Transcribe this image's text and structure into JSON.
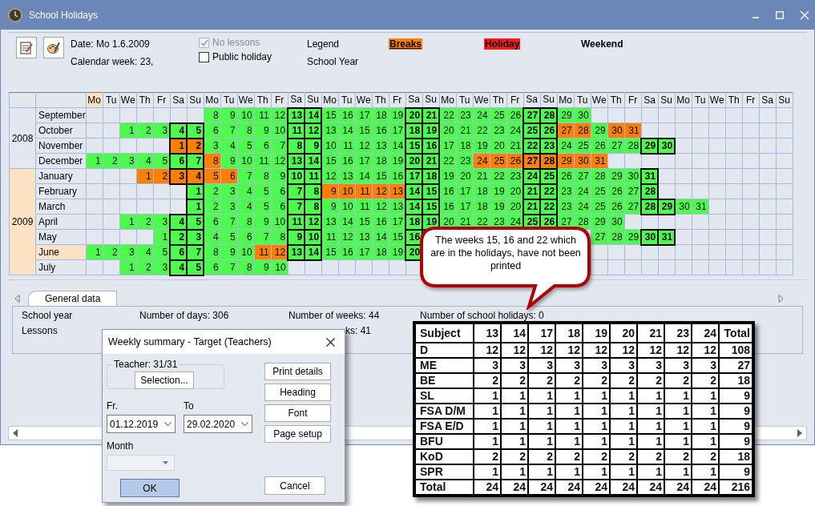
{
  "window": {
    "title": "School Holidays"
  },
  "toolbar": {
    "date": "Date: Mo 1.6.2009",
    "week": "Calendar week: 23,",
    "checkboxes": [
      {
        "label": "No lessons",
        "checked": true,
        "disabled": true
      },
      {
        "label": "Public holiday",
        "checked": false,
        "disabled": false
      }
    ],
    "legend_title": "Legend",
    "school_year_label": "School Year",
    "legend": [
      {
        "label": "Breaks",
        "kind": "break"
      },
      {
        "label": "Holiday",
        "kind": "holiday"
      },
      {
        "label": "Weekend",
        "kind": "weekend"
      }
    ]
  },
  "calendar": {
    "headers": [
      {
        "label": "Mo",
        "selected": true
      },
      {
        "label": "Tu",
        "selected": false
      },
      {
        "label": "We",
        "selected": false
      },
      {
        "label": "Th",
        "selected": false
      },
      {
        "label": "Fr",
        "selected": false
      },
      {
        "label": "Sa",
        "selected": false
      },
      {
        "label": "Su",
        "selected": false
      },
      {
        "label": "Mo",
        "selected": false
      },
      {
        "label": "Tu",
        "selected": false
      },
      {
        "label": "We",
        "selected": false
      },
      {
        "label": "Th",
        "selected": false
      },
      {
        "label": "Fr",
        "selected": false
      },
      {
        "label": "Sa",
        "selected": false
      },
      {
        "label": "Su",
        "selected": false
      },
      {
        "label": "Mo",
        "selected": false
      },
      {
        "label": "Tu",
        "selected": false
      },
      {
        "label": "We",
        "selected": false
      },
      {
        "label": "Th",
        "selected": false
      },
      {
        "label": "Fr",
        "selected": false
      },
      {
        "label": "Sa",
        "selected": false
      },
      {
        "label": "Su",
        "selected": false
      },
      {
        "label": "Mo",
        "selected": false
      },
      {
        "label": "Tu",
        "selected": false
      },
      {
        "label": "We",
        "selected": false
      },
      {
        "label": "Th",
        "selected": false
      },
      {
        "label": "Fr",
        "selected": false
      },
      {
        "label": "Sa",
        "selected": false
      },
      {
        "label": "Su",
        "selected": false
      },
      {
        "label": "Mo",
        "selected": false
      },
      {
        "label": "Tu",
        "selected": false
      },
      {
        "label": "We",
        "selected": false
      },
      {
        "label": "Th",
        "selected": false
      },
      {
        "label": "Fr",
        "selected": false
      },
      {
        "label": "Sa",
        "selected": false
      },
      {
        "label": "Su",
        "selected": false
      },
      {
        "label": "Mo",
        "selected": false
      },
      {
        "label": "Tu",
        "selected": false
      },
      {
        "label": "We",
        "selected": false
      },
      {
        "label": "Th",
        "selected": false
      },
      {
        "label": "Fr",
        "selected": false
      },
      {
        "label": "Sa",
        "selected": false
      },
      {
        "label": "Su",
        "selected": false
      }
    ],
    "years": [
      {
        "year": "2008",
        "selected": false,
        "months": [
          {
            "name": "September",
            "selected": false,
            "cells": [
              {
                "kind": "blank"
              },
              {
                "kind": "blank"
              },
              {
                "kind": "blank"
              },
              {
                "kind": "blank"
              },
              {
                "kind": "blank"
              },
              {
                "kind": "blank"
              },
              {
                "kind": "blank"
              },
              {
                "day": "8",
                "kind": "school"
              },
              {
                "day": "9",
                "kind": "school"
              },
              {
                "day": "10",
                "kind": "school"
              },
              {
                "day": "11",
                "kind": "school"
              },
              {
                "day": "12",
                "kind": "school"
              },
              {
                "day": "13",
                "kind": "school"
              },
              {
                "day": "14",
                "kind": "school"
              },
              {
                "day": "15",
                "kind": "school"
              },
              {
                "day": "16",
                "kind": "school"
              },
              {
                "day": "17",
                "kind": "school"
              },
              {
                "day": "18",
                "kind": "school"
              },
              {
                "day": "19",
                "kind": "school"
              },
              {
                "day": "20",
                "kind": "school"
              },
              {
                "day": "21",
                "kind": "school"
              },
              {
                "day": "22",
                "kind": "school"
              },
              {
                "day": "23",
                "kind": "school"
              },
              {
                "day": "24",
                "kind": "school"
              },
              {
                "day": "25",
                "kind": "school"
              },
              {
                "day": "26",
                "kind": "school"
              },
              {
                "day": "27",
                "kind": "school"
              },
              {
                "day": "28",
                "kind": "school"
              },
              {
                "day": "29",
                "kind": "school"
              },
              {
                "day": "30",
                "kind": "school"
              }
            ]
          },
          {
            "name": "October",
            "selected": false,
            "cells": [
              {
                "kind": "blank"
              },
              {
                "kind": "blank"
              },
              {
                "day": "1",
                "kind": "school"
              },
              {
                "day": "2",
                "kind": "school"
              },
              {
                "day": "3",
                "kind": "school"
              },
              {
                "day": "4",
                "kind": "school"
              },
              {
                "day": "5",
                "kind": "school"
              },
              {
                "day": "6",
                "kind": "school"
              },
              {
                "day": "7",
                "kind": "school"
              },
              {
                "day": "8",
                "kind": "school"
              },
              {
                "day": "9",
                "kind": "school"
              },
              {
                "day": "10",
                "kind": "school"
              },
              {
                "day": "11",
                "kind": "school"
              },
              {
                "day": "12",
                "kind": "school"
              },
              {
                "day": "13",
                "kind": "school"
              },
              {
                "day": "14",
                "kind": "school"
              },
              {
                "day": "15",
                "kind": "school"
              },
              {
                "day": "16",
                "kind": "school"
              },
              {
                "day": "17",
                "kind": "school"
              },
              {
                "day": "18",
                "kind": "school"
              },
              {
                "day": "19",
                "kind": "school"
              },
              {
                "day": "20",
                "kind": "school"
              },
              {
                "day": "21",
                "kind": "school"
              },
              {
                "day": "22",
                "kind": "school"
              },
              {
                "day": "23",
                "kind": "school"
              },
              {
                "day": "24",
                "kind": "school"
              },
              {
                "day": "25",
                "kind": "school"
              },
              {
                "day": "26",
                "kind": "school"
              },
              {
                "day": "27",
                "kind": "break"
              },
              {
                "day": "28",
                "kind": "break"
              },
              {
                "day": "29",
                "kind": "school"
              },
              {
                "day": "30",
                "kind": "break"
              },
              {
                "day": "31",
                "kind": "break"
              }
            ]
          },
          {
            "name": "November",
            "selected": false,
            "cells": [
              {
                "kind": "blank"
              },
              {
                "kind": "blank"
              },
              {
                "kind": "blank"
              },
              {
                "kind": "blank"
              },
              {
                "kind": "blank"
              },
              {
                "day": "1",
                "kind": "break"
              },
              {
                "day": "2",
                "kind": "break"
              },
              {
                "day": "3",
                "kind": "school"
              },
              {
                "day": "4",
                "kind": "school"
              },
              {
                "day": "5",
                "kind": "school"
              },
              {
                "day": "6",
                "kind": "school"
              },
              {
                "day": "7",
                "kind": "school"
              },
              {
                "day": "8",
                "kind": "school"
              },
              {
                "day": "9",
                "kind": "school"
              },
              {
                "day": "10",
                "kind": "school"
              },
              {
                "day": "11",
                "kind": "school"
              },
              {
                "day": "12",
                "kind": "school"
              },
              {
                "day": "13",
                "kind": "school"
              },
              {
                "day": "14",
                "kind": "school"
              },
              {
                "day": "15",
                "kind": "school"
              },
              {
                "day": "16",
                "kind": "school"
              },
              {
                "day": "17",
                "kind": "school"
              },
              {
                "day": "18",
                "kind": "school"
              },
              {
                "day": "19",
                "kind": "school"
              },
              {
                "day": "20",
                "kind": "school"
              },
              {
                "day": "21",
                "kind": "school"
              },
              {
                "day": "22",
                "kind": "school"
              },
              {
                "day": "23",
                "kind": "school"
              },
              {
                "day": "24",
                "kind": "school"
              },
              {
                "day": "25",
                "kind": "school"
              },
              {
                "day": "26",
                "kind": "school"
              },
              {
                "day": "27",
                "kind": "school"
              },
              {
                "day": "28",
                "kind": "school"
              },
              {
                "day": "29",
                "kind": "school"
              },
              {
                "day": "30",
                "kind": "school"
              }
            ]
          },
          {
            "name": "December",
            "selected": false,
            "cells": [
              {
                "day": "1",
                "kind": "school"
              },
              {
                "day": "2",
                "kind": "school"
              },
              {
                "day": "3",
                "kind": "school"
              },
              {
                "day": "4",
                "kind": "school"
              },
              {
                "day": "5",
                "kind": "school"
              },
              {
                "day": "6",
                "kind": "school"
              },
              {
                "day": "7",
                "kind": "school"
              },
              {
                "day": "8",
                "kind": "break"
              },
              {
                "day": "9",
                "kind": "school"
              },
              {
                "day": "10",
                "kind": "school"
              },
              {
                "day": "11",
                "kind": "school"
              },
              {
                "day": "12",
                "kind": "school"
              },
              {
                "day": "13",
                "kind": "school"
              },
              {
                "day": "14",
                "kind": "school"
              },
              {
                "day": "15",
                "kind": "school"
              },
              {
                "day": "16",
                "kind": "school"
              },
              {
                "day": "17",
                "kind": "school"
              },
              {
                "day": "18",
                "kind": "school"
              },
              {
                "day": "19",
                "kind": "school"
              },
              {
                "day": "20",
                "kind": "school"
              },
              {
                "day": "21",
                "kind": "school"
              },
              {
                "day": "22",
                "kind": "school"
              },
              {
                "day": "23",
                "kind": "school"
              },
              {
                "day": "24",
                "kind": "break"
              },
              {
                "day": "25",
                "kind": "break"
              },
              {
                "day": "26",
                "kind": "break"
              },
              {
                "day": "27",
                "kind": "break"
              },
              {
                "day": "28",
                "kind": "break"
              },
              {
                "day": "29",
                "kind": "break"
              },
              {
                "day": "30",
                "kind": "break"
              },
              {
                "day": "31",
                "kind": "break"
              }
            ]
          }
        ]
      },
      {
        "year": "2009",
        "selected": true,
        "months": [
          {
            "name": "January",
            "selected": false,
            "cells": [
              {
                "kind": "blank"
              },
              {
                "kind": "blank"
              },
              {
                "kind": "blank"
              },
              {
                "day": "1",
                "kind": "break"
              },
              {
                "day": "2",
                "kind": "break"
              },
              {
                "day": "3",
                "kind": "break"
              },
              {
                "day": "4",
                "kind": "break"
              },
              {
                "day": "5",
                "kind": "break"
              },
              {
                "day": "6",
                "kind": "break"
              },
              {
                "day": "7",
                "kind": "school"
              },
              {
                "day": "8",
                "kind": "school"
              },
              {
                "day": "9",
                "kind": "school"
              },
              {
                "day": "10",
                "kind": "school"
              },
              {
                "day": "11",
                "kind": "school"
              },
              {
                "day": "12",
                "kind": "school"
              },
              {
                "day": "13",
                "kind": "school"
              },
              {
                "day": "14",
                "kind": "school"
              },
              {
                "day": "15",
                "kind": "school"
              },
              {
                "day": "16",
                "kind": "school"
              },
              {
                "day": "17",
                "kind": "school"
              },
              {
                "day": "18",
                "kind": "school"
              },
              {
                "day": "19",
                "kind": "school"
              },
              {
                "day": "20",
                "kind": "school"
              },
              {
                "day": "21",
                "kind": "school"
              },
              {
                "day": "22",
                "kind": "school"
              },
              {
                "day": "23",
                "kind": "school"
              },
              {
                "day": "24",
                "kind": "school"
              },
              {
                "day": "25",
                "kind": "school"
              },
              {
                "day": "26",
                "kind": "school"
              },
              {
                "day": "27",
                "kind": "school"
              },
              {
                "day": "28",
                "kind": "school"
              },
              {
                "day": "29",
                "kind": "school"
              },
              {
                "day": "30",
                "kind": "school"
              },
              {
                "day": "31",
                "kind": "school"
              }
            ]
          },
          {
            "name": "February",
            "selected": false,
            "cells": [
              {
                "kind": "blank"
              },
              {
                "kind": "blank"
              },
              {
                "kind": "blank"
              },
              {
                "kind": "blank"
              },
              {
                "kind": "blank"
              },
              {
                "kind": "blank"
              },
              {
                "day": "1",
                "kind": "school"
              },
              {
                "day": "2",
                "kind": "school"
              },
              {
                "day": "3",
                "kind": "school"
              },
              {
                "day": "4",
                "kind": "school"
              },
              {
                "day": "5",
                "kind": "school"
              },
              {
                "day": "6",
                "kind": "school"
              },
              {
                "day": "7",
                "kind": "school"
              },
              {
                "day": "8",
                "kind": "school"
              },
              {
                "day": "9",
                "kind": "break"
              },
              {
                "day": "10",
                "kind": "break"
              },
              {
                "day": "11",
                "kind": "break"
              },
              {
                "day": "12",
                "kind": "break"
              },
              {
                "day": "13",
                "kind": "break"
              },
              {
                "day": "14",
                "kind": "school"
              },
              {
                "day": "15",
                "kind": "school"
              },
              {
                "day": "16",
                "kind": "school"
              },
              {
                "day": "17",
                "kind": "school"
              },
              {
                "day": "18",
                "kind": "school"
              },
              {
                "day": "19",
                "kind": "school"
              },
              {
                "day": "20",
                "kind": "school"
              },
              {
                "day": "21",
                "kind": "school"
              },
              {
                "day": "22",
                "kind": "school"
              },
              {
                "day": "23",
                "kind": "school"
              },
              {
                "day": "24",
                "kind": "school"
              },
              {
                "day": "25",
                "kind": "school"
              },
              {
                "day": "26",
                "kind": "school"
              },
              {
                "day": "27",
                "kind": "school"
              },
              {
                "day": "28",
                "kind": "school"
              }
            ]
          },
          {
            "name": "March",
            "selected": false,
            "cells": [
              {
                "kind": "blank"
              },
              {
                "kind": "blank"
              },
              {
                "kind": "blank"
              },
              {
                "kind": "blank"
              },
              {
                "kind": "blank"
              },
              {
                "kind": "blank"
              },
              {
                "day": "1",
                "kind": "school"
              },
              {
                "day": "2",
                "kind": "school"
              },
              {
                "day": "3",
                "kind": "school"
              },
              {
                "day": "4",
                "kind": "school"
              },
              {
                "day": "5",
                "kind": "school"
              },
              {
                "day": "6",
                "kind": "school"
              },
              {
                "day": "7",
                "kind": "school"
              },
              {
                "day": "8",
                "kind": "school"
              },
              {
                "day": "9",
                "kind": "school"
              },
              {
                "day": "10",
                "kind": "school"
              },
              {
                "day": "11",
                "kind": "school"
              },
              {
                "day": "12",
                "kind": "school"
              },
              {
                "day": "13",
                "kind": "school"
              },
              {
                "day": "14",
                "kind": "school"
              },
              {
                "day": "15",
                "kind": "school"
              },
              {
                "day": "16",
                "kind": "school"
              },
              {
                "day": "17",
                "kind": "school"
              },
              {
                "day": "18",
                "kind": "school"
              },
              {
                "day": "19",
                "kind": "school"
              },
              {
                "day": "20",
                "kind": "school"
              },
              {
                "day": "21",
                "kind": "school"
              },
              {
                "day": "22",
                "kind": "school"
              },
              {
                "day": "23",
                "kind": "school"
              },
              {
                "day": "24",
                "kind": "school"
              },
              {
                "day": "25",
                "kind": "school"
              },
              {
                "day": "26",
                "kind": "school"
              },
              {
                "day": "27",
                "kind": "school"
              },
              {
                "day": "28",
                "kind": "school"
              },
              {
                "day": "29",
                "kind": "school"
              },
              {
                "day": "30",
                "kind": "school"
              },
              {
                "day": "31",
                "kind": "school"
              }
            ]
          },
          {
            "name": "April",
            "selected": false,
            "cells": [
              {
                "kind": "blank"
              },
              {
                "kind": "blank"
              },
              {
                "day": "1",
                "kind": "school"
              },
              {
                "day": "2",
                "kind": "school"
              },
              {
                "day": "3",
                "kind": "school"
              },
              {
                "day": "4",
                "kind": "school"
              },
              {
                "day": "5",
                "kind": "school"
              },
              {
                "day": "6",
                "kind": "school"
              },
              {
                "day": "7",
                "kind": "school"
              },
              {
                "day": "8",
                "kind": "school"
              },
              {
                "day": "9",
                "kind": "school"
              },
              {
                "day": "10",
                "kind": "school"
              },
              {
                "day": "11",
                "kind": "school"
              },
              {
                "day": "12",
                "kind": "school"
              },
              {
                "day": "13",
                "kind": "school"
              },
              {
                "day": "14",
                "kind": "school"
              },
              {
                "day": "15",
                "kind": "school"
              },
              {
                "day": "16",
                "kind": "school"
              },
              {
                "day": "17",
                "kind": "school"
              },
              {
                "day": "18",
                "kind": "school"
              },
              {
                "day": "19",
                "kind": "school"
              },
              {
                "day": "20",
                "kind": "school"
              },
              {
                "day": "21",
                "kind": "school"
              },
              {
                "day": "22",
                "kind": "school"
              },
              {
                "day": "23",
                "kind": "school"
              },
              {
                "day": "24",
                "kind": "school"
              },
              {
                "day": "25",
                "kind": "school"
              },
              {
                "day": "26",
                "kind": "school"
              },
              {
                "day": "27",
                "kind": "school"
              },
              {
                "day": "28",
                "kind": "school"
              },
              {
                "day": "29",
                "kind": "school"
              },
              {
                "day": "30",
                "kind": "school"
              }
            ]
          },
          {
            "name": "May",
            "selected": false,
            "cells": [
              {
                "kind": "blank"
              },
              {
                "kind": "blank"
              },
              {
                "kind": "blank"
              },
              {
                "kind": "blank"
              },
              {
                "day": "1",
                "kind": "school"
              },
              {
                "day": "2",
                "kind": "school"
              },
              {
                "day": "3",
                "kind": "school"
              },
              {
                "day": "4",
                "kind": "school"
              },
              {
                "day": "5",
                "kind": "school"
              },
              {
                "day": "6",
                "kind": "school"
              },
              {
                "day": "7",
                "kind": "school"
              },
              {
                "day": "8",
                "kind": "school"
              },
              {
                "day": "9",
                "kind": "school"
              },
              {
                "day": "10",
                "kind": "school"
              },
              {
                "day": "11",
                "kind": "school"
              },
              {
                "day": "12",
                "kind": "school"
              },
              {
                "day": "13",
                "kind": "school"
              },
              {
                "day": "14",
                "kind": "school"
              },
              {
                "day": "15",
                "kind": "school"
              },
              {
                "day": "16",
                "kind": "school"
              },
              {
                "kind": "blank"
              },
              {
                "kind": "blank"
              },
              {
                "kind": "blank"
              },
              {
                "kind": "blank"
              },
              {
                "kind": "blank"
              },
              {
                "kind": "blank"
              },
              {
                "kind": "blank"
              },
              {
                "kind": "blank"
              },
              {
                "kind": "blank"
              },
              {
                "kind": "blank"
              },
              {
                "day": "27",
                "kind": "school"
              },
              {
                "day": "28",
                "kind": "school"
              },
              {
                "day": "29",
                "kind": "school"
              },
              {
                "day": "30",
                "kind": "school"
              },
              {
                "day": "31",
                "kind": "school"
              }
            ]
          },
          {
            "name": "June",
            "selected": true,
            "cells": [
              {
                "day": "1",
                "kind": "school"
              },
              {
                "day": "2",
                "kind": "school"
              },
              {
                "day": "3",
                "kind": "school"
              },
              {
                "day": "4",
                "kind": "school"
              },
              {
                "day": "5",
                "kind": "school"
              },
              {
                "day": "6",
                "kind": "school"
              },
              {
                "day": "7",
                "kind": "school"
              },
              {
                "day": "8",
                "kind": "school"
              },
              {
                "day": "9",
                "kind": "school"
              },
              {
                "day": "10",
                "kind": "school"
              },
              {
                "day": "11",
                "kind": "break"
              },
              {
                "day": "12",
                "kind": "break"
              },
              {
                "day": "13",
                "kind": "school"
              },
              {
                "day": "14",
                "kind": "school"
              },
              {
                "day": "15",
                "kind": "school"
              },
              {
                "day": "16",
                "kind": "school"
              },
              {
                "day": "17",
                "kind": "school"
              },
              {
                "day": "18",
                "kind": "school"
              },
              {
                "day": "19",
                "kind": "school"
              },
              {
                "day": "20",
                "kind": "school"
              }
            ]
          },
          {
            "name": "July",
            "selected": false,
            "cells": [
              {
                "kind": "blank"
              },
              {
                "kind": "blank"
              },
              {
                "day": "1",
                "kind": "school"
              },
              {
                "day": "2",
                "kind": "school"
              },
              {
                "day": "3",
                "kind": "school"
              },
              {
                "day": "4",
                "kind": "school"
              },
              {
                "day": "5",
                "kind": "school"
              },
              {
                "day": "6",
                "kind": "school"
              },
              {
                "day": "7",
                "kind": "school"
              },
              {
                "day": "8",
                "kind": "school"
              },
              {
                "day": "9",
                "kind": "school"
              },
              {
                "day": "10",
                "kind": "school"
              }
            ]
          }
        ]
      }
    ]
  },
  "general": {
    "tabs": [
      {
        "label": "General data",
        "selected": true
      }
    ],
    "info_rows": [
      [
        "School year",
        "Number of days: 306",
        "Number of weeks: 44",
        "Number of school holidays: 0"
      ],
      [
        "Lessons",
        "ks: 41"
      ]
    ]
  },
  "dialog": {
    "title": "Weekly summary - Target (Teachers)",
    "group_label": "Teacher: 31/31",
    "selection_button": "Selection...",
    "from_label": "Fr.",
    "from_value": "01.12.2019",
    "to_label": "To",
    "to_value": "29.02.2020",
    "month_label": "Month",
    "month_field": {
      "disabled": true
    },
    "side_buttons": [
      "Print details",
      "Heading",
      "Font",
      "Page setup"
    ],
    "buttons": [
      {
        "label": "OK",
        "default": true
      },
      {
        "label": "Cancel",
        "default": false
      }
    ]
  },
  "summary_table": {
    "columns": [
      "Subject",
      "13",
      "14",
      "17",
      "18",
      "19",
      "20",
      "21",
      "23",
      "24",
      "Total"
    ],
    "rows": [
      [
        "D",
        "12",
        "12",
        "12",
        "12",
        "12",
        "12",
        "12",
        "12",
        "12",
        "108"
      ],
      [
        "ME",
        "3",
        "3",
        "3",
        "3",
        "3",
        "3",
        "3",
        "3",
        "3",
        "27"
      ],
      [
        "BE",
        "2",
        "2",
        "2",
        "2",
        "2",
        "2",
        "2",
        "2",
        "2",
        "18"
      ],
      [
        "SL",
        "1",
        "1",
        "1",
        "1",
        "1",
        "1",
        "1",
        "1",
        "1",
        "9"
      ],
      [
        "FSA D/M",
        "1",
        "1",
        "1",
        "1",
        "1",
        "1",
        "1",
        "1",
        "1",
        "9"
      ],
      [
        "FSA E/D",
        "1",
        "1",
        "1",
        "1",
        "1",
        "1",
        "1",
        "1",
        "1",
        "9"
      ],
      [
        "BFU",
        "1",
        "1",
        "1",
        "1",
        "1",
        "1",
        "1",
        "1",
        "1",
        "9"
      ],
      [
        "KoD",
        "2",
        "2",
        "2",
        "2",
        "2",
        "2",
        "2",
        "2",
        "2",
        "18"
      ],
      [
        "SPR",
        "1",
        "1",
        "1",
        "1",
        "1",
        "1",
        "1",
        "1",
        "1",
        "9"
      ],
      [
        "Total",
        "24",
        "24",
        "24",
        "24",
        "24",
        "24",
        "24",
        "24",
        "24",
        "216"
      ]
    ]
  },
  "callout": {
    "text": "The weeks 15, 16 and 22 which are in the holidays, have not been printed"
  }
}
